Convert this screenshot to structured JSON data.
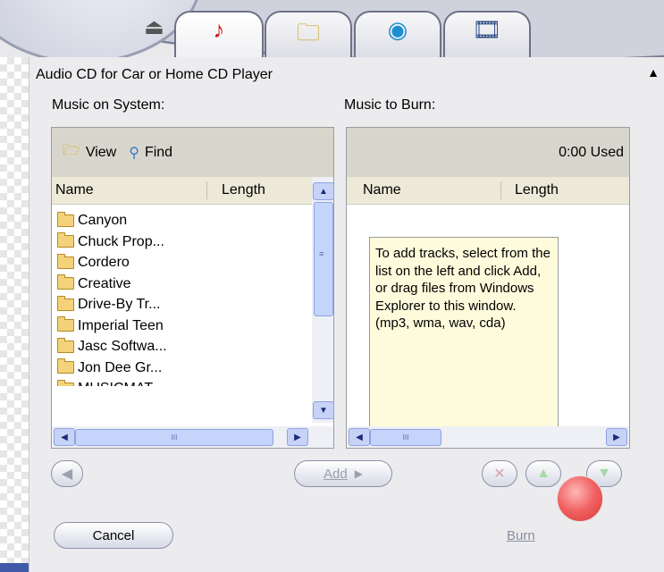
{
  "tabs": [
    {
      "name": "eject",
      "icon": "⏏"
    },
    {
      "name": "audio",
      "icon": "♪"
    },
    {
      "name": "data",
      "icon": "🗀"
    },
    {
      "name": "video",
      "icon": "◉"
    },
    {
      "name": "film",
      "icon": "🎞"
    }
  ],
  "panel": {
    "title": "Audio CD for Car or Home CD Player",
    "collapse_icon": "▲"
  },
  "system_list": {
    "label": "Music on System:",
    "view_label": "View",
    "find_label": "Find",
    "columns": [
      "Name",
      "Length"
    ],
    "items": [
      "Canyon",
      "Chuck Prop...",
      "Cordero",
      "Creative",
      "Drive-By Tr...",
      "Imperial Teen",
      "Jasc Softwa...",
      "Jon Dee Gr...",
      "MUSICMAT..."
    ]
  },
  "burn_list": {
    "label": "Music to Burn:",
    "used": "0:00 Used",
    "columns": [
      "Name",
      "Length"
    ],
    "hint": "To add tracks, select from the list on the left and click Add, or drag files from Windows Explorer to this window. (mp3, wma, wav, cda)"
  },
  "buttons": {
    "back_icon": "◀",
    "add": "Add",
    "add_arrow": "▶",
    "remove_icon": "✕",
    "up_icon": "▲",
    "down_icon": "▼",
    "cancel": "Cancel",
    "burn": "Burn"
  },
  "scroll": {
    "up": "▲",
    "down": "▼",
    "left": "◀",
    "right": "▶",
    "grip_v": "≡",
    "grip_h": "III"
  }
}
